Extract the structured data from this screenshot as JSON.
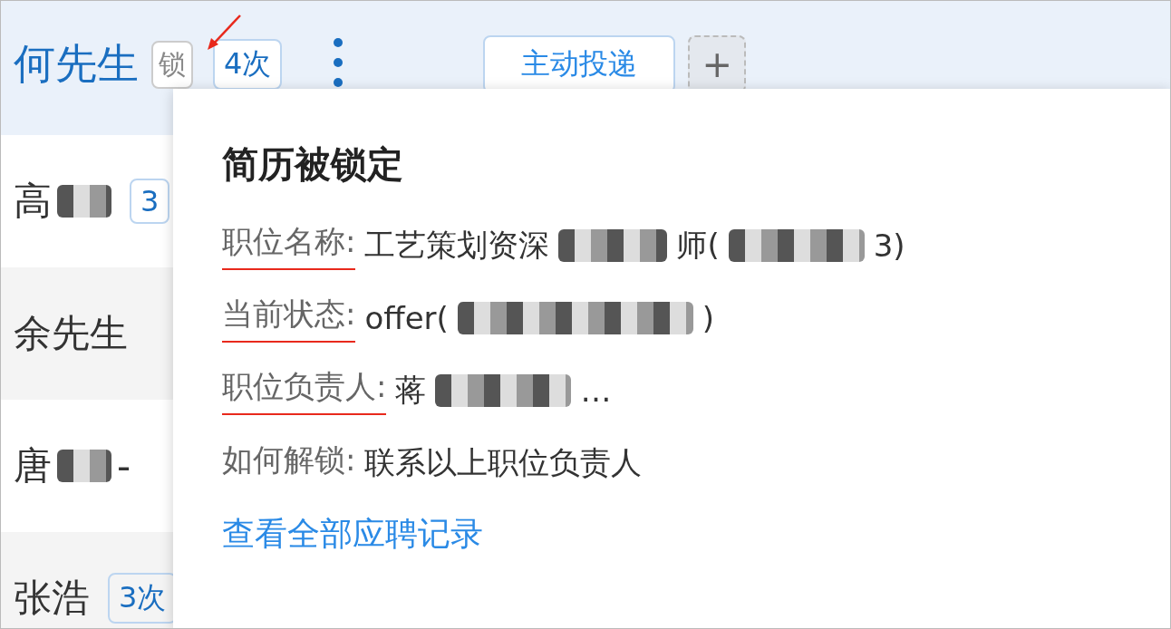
{
  "header": {
    "name": "何先生",
    "lock_badge": {
      "text": "锁",
      "annotated": true
    },
    "count_badge": "4次",
    "tabs": [
      {
        "label": "主动投递",
        "selected": true
      }
    ],
    "add_button": "+"
  },
  "candidates": [
    {
      "parts": [
        {
          "kind": "text",
          "text": "高"
        },
        {
          "kind": "redacted"
        }
      ],
      "badge": "3"
    },
    {
      "parts": [
        {
          "kind": "text",
          "text": "余先生"
        }
      ]
    },
    {
      "parts": [
        {
          "kind": "text",
          "text": "唐"
        },
        {
          "kind": "redacted"
        },
        {
          "kind": "text",
          "text": "-"
        }
      ]
    },
    {
      "parts": [
        {
          "kind": "text",
          "text": "张浩"
        }
      ],
      "badge": "3次"
    }
  ],
  "popover": {
    "title": "简历被锁定",
    "fields": [
      {
        "label": "职位名称:",
        "underlined": true,
        "value": [
          {
            "kind": "text",
            "text": "工艺策划资深"
          },
          {
            "kind": "redacted"
          },
          {
            "kind": "text",
            "text": "师("
          },
          {
            "kind": "redacted"
          },
          {
            "kind": "text",
            "text": "3)"
          }
        ]
      },
      {
        "label": "当前状态:",
        "underlined": true,
        "value": [
          {
            "kind": "text",
            "text": "offer("
          },
          {
            "kind": "redacted"
          },
          {
            "kind": "text",
            "text": ")"
          }
        ]
      },
      {
        "label": "职位负责人:",
        "underlined": true,
        "value": [
          {
            "kind": "text",
            "text": "蒋"
          },
          {
            "kind": "redacted"
          },
          {
            "kind": "text",
            "text": "…"
          }
        ]
      },
      {
        "label": "如何解锁:",
        "underlined": false,
        "value": [
          {
            "kind": "text",
            "text": "联系以上职位负责人"
          }
        ]
      }
    ],
    "link": "查看全部应聘记录"
  }
}
